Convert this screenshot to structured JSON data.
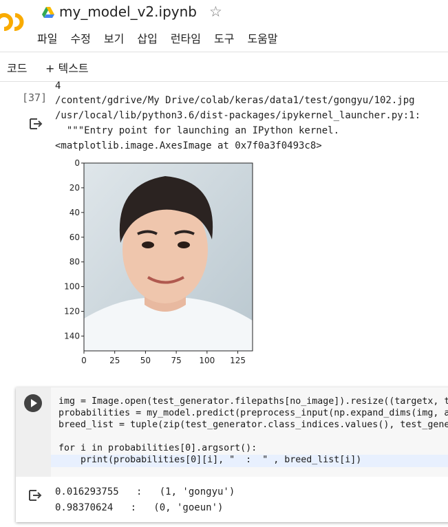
{
  "header": {
    "title": "my_model_v2.ipynb",
    "menu": [
      "파일",
      "수정",
      "보기",
      "삽입",
      "런타임",
      "도구",
      "도움말"
    ]
  },
  "toolbar": {
    "add_code": "코드",
    "add_text": "+ 텍스트"
  },
  "cell1": {
    "execution_count": "[37]",
    "output_lines": [
      "4",
      "/content/gdrive/My Drive/colab/keras/data1/test/gongyu/102.jpg",
      "/usr/local/lib/python3.6/dist-packages/ipykernel_launcher.py:1:",
      "  \"\"\"Entry point for launching an IPython kernel.",
      "<matplotlib.image.AxesImage at 0x7f0a3f0493c8>"
    ],
    "plot": {
      "y_ticks": [
        "0",
        "20",
        "40",
        "60",
        "80",
        "100",
        "120",
        "140"
      ],
      "x_ticks": [
        "0",
        "25",
        "50",
        "75",
        "100",
        "125"
      ]
    }
  },
  "cell2": {
    "code_lines": [
      "img = Image.open(test_generator.filepaths[no_image]).resize((targetx, t",
      "probabilities = my_model.predict(preprocess_input(np.expand_dims(img, a",
      "breed_list = tuple(zip(test_generator.class_indices.values(), test_gene",
      "",
      "for i in probabilities[0].argsort():",
      "    print(probabilities[0][i], \"  :  \" , breed_list[i])"
    ],
    "output_lines": [
      "0.016293755   :   (1, 'gongyu')",
      "0.98370624   :   (0, 'goeun')"
    ]
  }
}
